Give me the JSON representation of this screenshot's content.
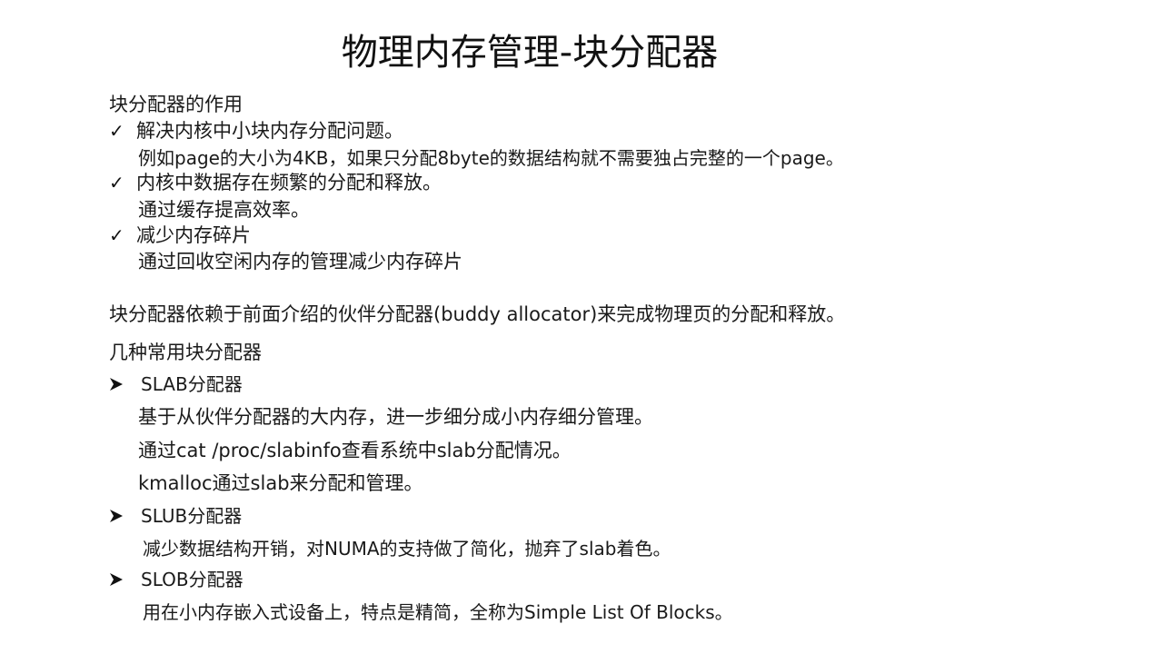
{
  "slide": {
    "title": "物理内存管理-块分配器",
    "section1": {
      "heading": "块分配器的作用",
      "items": [
        {
          "marker": "✓",
          "text": "解决内核中小块内存分配问题。",
          "detail": "例如page的大小为4KB，如果只分配8byte的数据结构就不需要独占完整的一个page。"
        },
        {
          "marker": "✓",
          "text": "内核中数据存在频繁的分配和释放。",
          "detail": "通过缓存提高效率。"
        },
        {
          "marker": "✓",
          "text": "减少内存碎片",
          "detail": "通过回收空闲内存的管理减少内存碎片"
        }
      ]
    },
    "dependency_text": "块分配器依赖于前面介绍的伙伴分配器(buddy allocator)来完成物理页的分配和释放。",
    "section2": {
      "heading": "几种常用块分配器",
      "allocators": [
        {
          "name": "SLAB分配器",
          "details": [
            "基于从伙伴分配器的大内存，进一步细分成小内存细分管理。",
            "通过cat /proc/slabinfo查看系统中slab分配情况。",
            "kmalloc通过slab来分配和管理。"
          ]
        },
        {
          "name": "SLUB分配器",
          "details": [
            "减少数据结构开销，对NUMA的支持做了简化，抛弃了slab着色。"
          ]
        },
        {
          "name": "SLOB分配器",
          "details": [
            "用在小内存嵌入式设备上，特点是精简，全称为Simple List Of Blocks。"
          ]
        }
      ]
    },
    "icons": {
      "check": "check-mark-icon",
      "arrow": "arrowhead-bullet-icon"
    }
  }
}
